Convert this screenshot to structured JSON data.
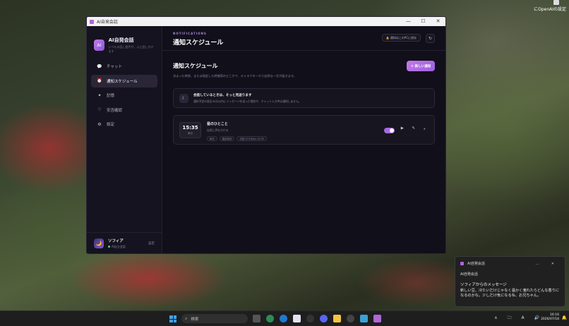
{
  "desktop": {
    "label": "にOpenAIの設定"
  },
  "window": {
    "title": "AI自発会話",
    "controls": {
      "minimize": "—",
      "maximize": "☐",
      "close": "✕"
    }
  },
  "sidebar": {
    "logo_text": "AI",
    "brand_title": "AI自発会話",
    "brand_sub": "いつもの話し相手が、ふと話しかけます",
    "items": [
      {
        "icon": "💬",
        "label": "チャット"
      },
      {
        "icon": "⏰",
        "label": "通知スケジュール",
        "active": true
      },
      {
        "icon": "✦",
        "label": "記憶"
      },
      {
        "icon": "♡",
        "label": "安否確認"
      },
      {
        "icon": "⚙",
        "label": "設定"
      }
    ],
    "user": {
      "avatar": "🌙",
      "name": "ソフィア",
      "status": "AI自立会話",
      "settings": "設定"
    }
  },
  "header": {
    "eyebrow": "NOTIFICATIONS",
    "title": "通知スケジュール",
    "pc_badge": "🔒 通知はこのPCに保存",
    "refresh_icon": "↻"
  },
  "section": {
    "title": "通知スケジュール",
    "desc": "決まった時刻、または指定した時間帯のどこかで、キャラクターから自然な一言が届きます。",
    "add_label": "＋ 新しい通知"
  },
  "notice": {
    "icon": "☾",
    "title": "会話しているときは、そっと見送ります",
    "sub": "通知予定の直近30分以内にメッセージを送った場合や、チャット入力中は通知しません。"
  },
  "schedule": {
    "time": "15:35",
    "days": "毎日",
    "name": "昼のひとこと",
    "sub": "自然に声をかける",
    "tags": [
      "毎日",
      "固定時刻",
      "次回 07/18(木) 15:35"
    ],
    "enabled": true,
    "play_icon": "▶",
    "edit_icon": "✎",
    "delete_icon": "✕"
  },
  "toast": {
    "app": "AI自発会話",
    "sender": "AI自発会話",
    "controls": "…  ✕",
    "title": "ソフィアからのメッセージ",
    "body": "新しい豆、冷たいだけじゃなく温かく淹れたらどんな香りになるのかな。少しだけ気になるね、お兄ちゃん。"
  },
  "taskbar": {
    "search_placeholder": "検索",
    "clock_time": "16:16",
    "clock_date": "2026/07/18",
    "tray": "∧ 🗀 A 🔊"
  }
}
